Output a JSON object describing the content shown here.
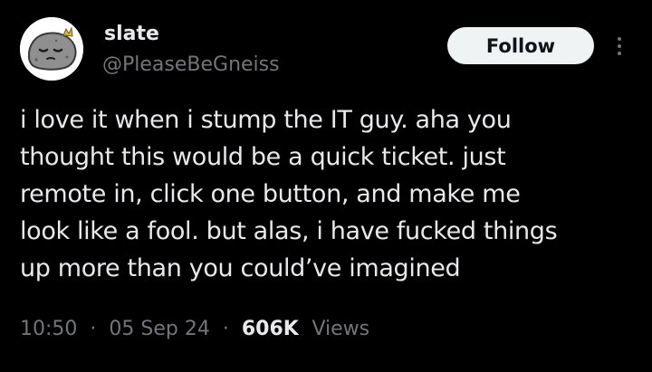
{
  "author": {
    "display_name": "slate",
    "handle": "@PleaseBeGneiss",
    "avatar_icon": "grey-rock-blob-avatar"
  },
  "actions": {
    "follow_label": "Follow",
    "more_icon": "more-vertical-icon"
  },
  "post": {
    "lines": [
      "i love it when i stump the IT guy. aha you",
      "thought this would be a quick ticket. just",
      "remote in, click one button, and make me",
      "look like a fool. but alas, i have fucked things",
      "up more than you could’ve imagined"
    ]
  },
  "meta": {
    "time": "10:50",
    "separator": "·",
    "date": "05 Sep 24",
    "views_count": "606K",
    "views_label": "Views"
  },
  "colors": {
    "background": "#000000",
    "primary_text": "#e7e9ea",
    "secondary_text": "#71767b",
    "follow_button_bg": "#eff3f4"
  }
}
